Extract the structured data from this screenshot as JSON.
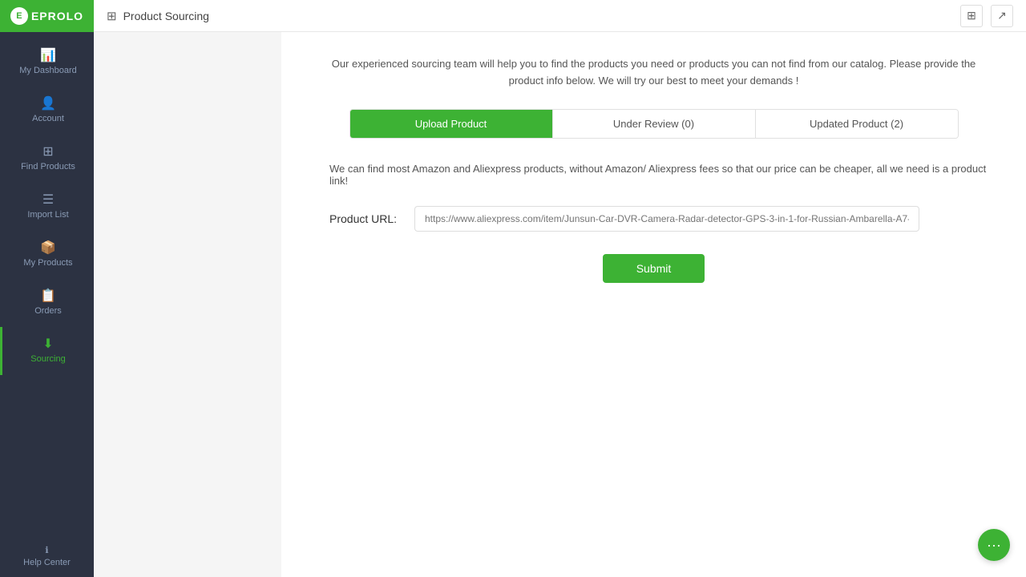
{
  "sidebar": {
    "logo": {
      "icon": "E",
      "text": "EPROLO"
    },
    "items": [
      {
        "id": "dashboard",
        "label": "My Dashboard",
        "icon": "📊",
        "active": false
      },
      {
        "id": "account",
        "label": "Account",
        "icon": "👤",
        "active": false
      },
      {
        "id": "find-products",
        "label": "Find Products",
        "icon": "⊞",
        "active": false
      },
      {
        "id": "import-list",
        "label": "Import List",
        "icon": "☰",
        "active": false
      },
      {
        "id": "my-products",
        "label": "My Products",
        "icon": "📦",
        "active": false
      },
      {
        "id": "orders",
        "label": "Orders",
        "icon": "📋",
        "active": false
      },
      {
        "id": "sourcing",
        "label": "Sourcing",
        "icon": "⬇",
        "active": true
      }
    ],
    "help": {
      "label": "Help Center",
      "icon": "ℹ"
    }
  },
  "topbar": {
    "title": "Product Sourcing",
    "icon": "⊞"
  },
  "main": {
    "description": "Our experienced sourcing team will help you to find the products you need or products you can not find from our catalog. Please provide the product info below. We will try our best to meet your demands !",
    "tabs": [
      {
        "id": "upload",
        "label": "Upload Product",
        "active": true
      },
      {
        "id": "review",
        "label": "Under Review (0)",
        "active": false
      },
      {
        "id": "updated",
        "label": "Updated Product (2)",
        "active": false
      }
    ],
    "info_text": "We can find most Amazon and Aliexpress products, without Amazon/ Aliexpress fees so that our price can be cheaper, all we need is a product link!",
    "product_url": {
      "label": "Product URL:",
      "placeholder": "https://www.aliexpress.com/item/Junsun-Car-DVR-Camera-Radar-detector-GPS-3-in-1-for-Russian-Ambarella-A7-a..."
    },
    "submit_label": "Submit"
  },
  "chat": {
    "icon": "···"
  }
}
